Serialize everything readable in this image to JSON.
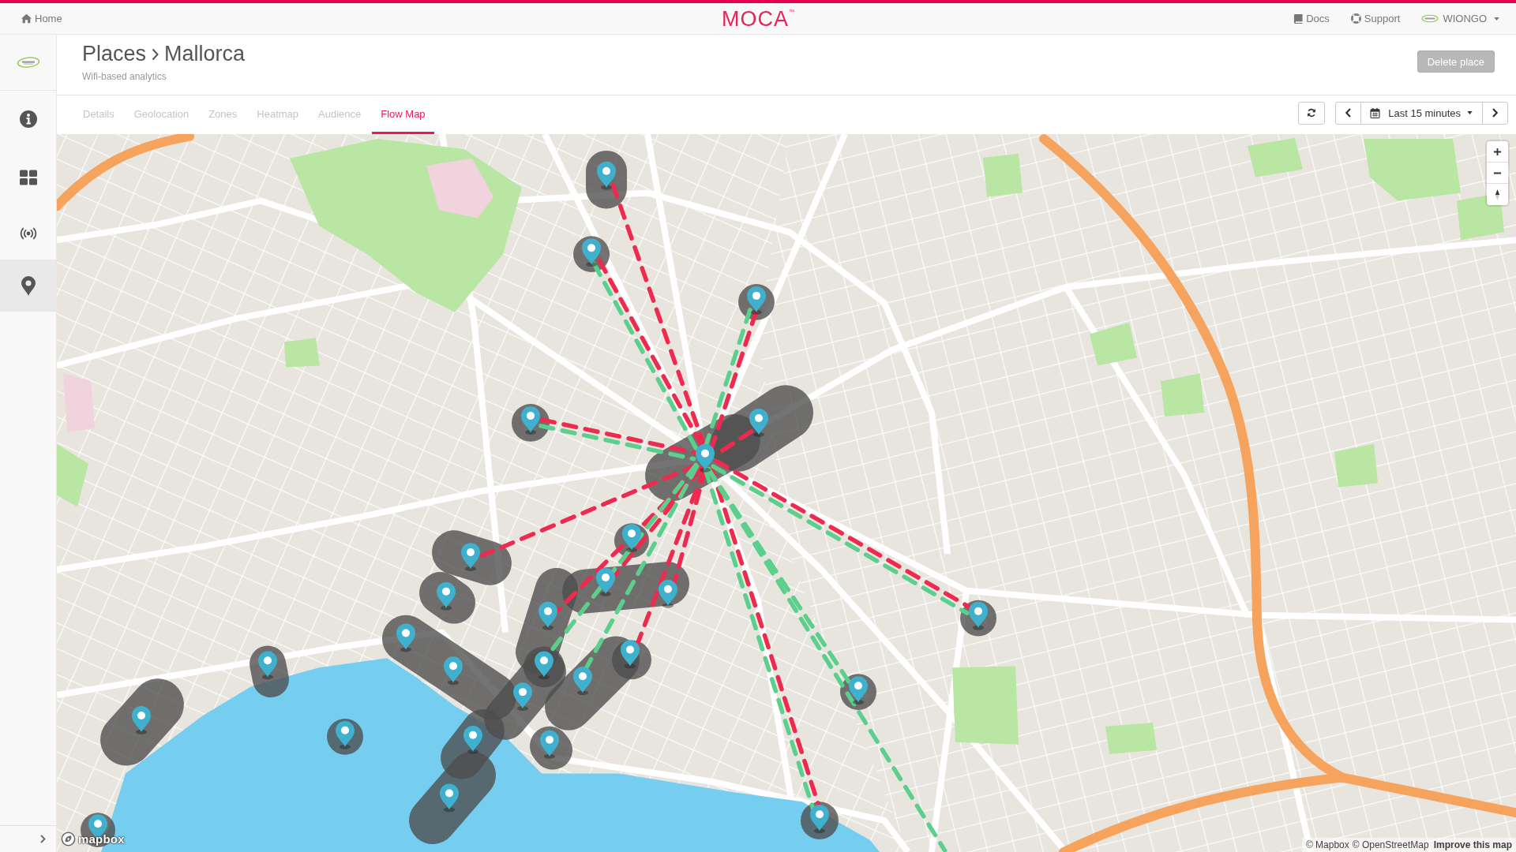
{
  "navbar": {
    "home": "Home",
    "logo": "MOCA",
    "logo_mark": "™",
    "docs": "Docs",
    "support": "Support",
    "account": "WIONGO"
  },
  "sidebar": {
    "items": [
      {
        "kind": "info",
        "selected": false
      },
      {
        "kind": "dashboard",
        "selected": false
      },
      {
        "kind": "sensors",
        "selected": false
      },
      {
        "kind": "places",
        "selected": true
      }
    ]
  },
  "header": {
    "breadcrumb": [
      "Places",
      "Mallorca"
    ],
    "subtitle": "Wifi-based analytics",
    "delete_button": {
      "label": "Delete place",
      "disabled": true
    }
  },
  "tabs": [
    {
      "label": "Details",
      "selected": false
    },
    {
      "label": "Geolocation",
      "selected": false
    },
    {
      "label": "Zones",
      "selected": false
    },
    {
      "label": "Heatmap",
      "selected": false
    },
    {
      "label": "Audience",
      "selected": false
    },
    {
      "label": "Flow Map",
      "selected": true
    }
  ],
  "toolbar": {
    "range": "Last 15 minutes"
  },
  "map": {
    "logo": "mapbox",
    "attribution": [
      "© Mapbox",
      "© OpenStreetMap"
    ],
    "improve_link": "Improve this map"
  }
}
